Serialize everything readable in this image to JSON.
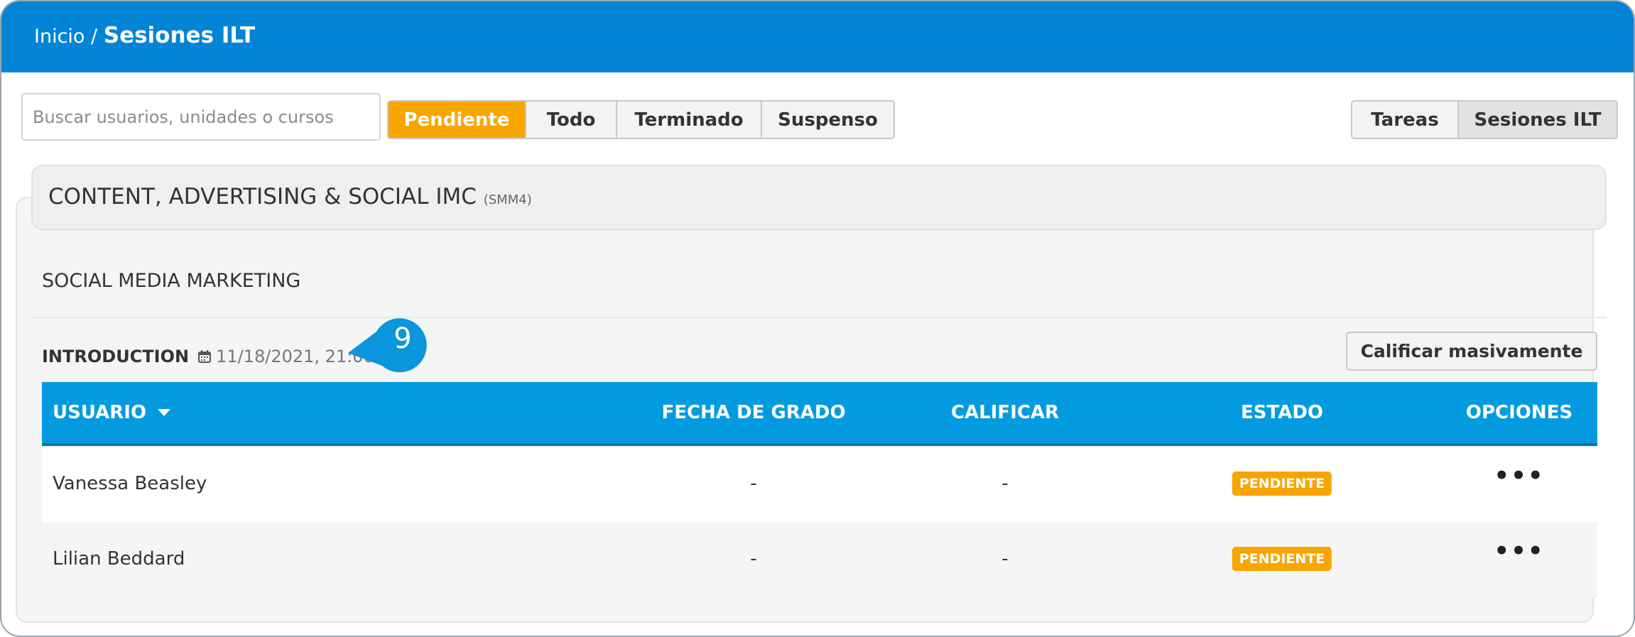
{
  "breadcrumb": {
    "home": "Inicio",
    "separator": "/",
    "current": "Sesiones ILT"
  },
  "search": {
    "placeholder": "Buscar usuarios, unidades o cursos",
    "value": ""
  },
  "status_filter": {
    "tabs": [
      "Pendiente",
      "Todo",
      "Terminado",
      "Suspenso"
    ],
    "active": "Pendiente"
  },
  "view_switch": {
    "tabs": [
      "Tareas",
      "Sesiones ILT"
    ],
    "active": "Sesiones ILT"
  },
  "course": {
    "title": "CONTENT, ADVERTISING & SOCIAL IMC",
    "code": "(SMM4)"
  },
  "module": {
    "title": "SOCIAL MEDIA MARKETING"
  },
  "session": {
    "name": "INTRODUCTION",
    "date": "11/18/2021, 21:00",
    "callout": "9"
  },
  "mass_grade_button": "Calificar masivamente",
  "table": {
    "columns": [
      "USUARIO",
      "FECHA DE GRADO",
      "CALIFICAR",
      "ESTADO",
      "OPCIONES"
    ],
    "rows": [
      {
        "user": "Vanessa Beasley",
        "grade_date": "-",
        "grade": "-",
        "status": "PENDIENTE",
        "options": "•••"
      },
      {
        "user": "Lilian Beddard",
        "grade_date": "-",
        "grade": "-",
        "status": "PENDIENTE",
        "options": "•••"
      }
    ]
  },
  "colors": {
    "header_blue": "#0284d7",
    "table_header_blue": "#039be0",
    "accent_orange": "#f9a500",
    "callout_blue": "#0a95dc"
  },
  "icons": {
    "session_date": "calendar-icon",
    "sort": "sort-down-caret-icon",
    "row_options": "more-horizontal-icon"
  }
}
